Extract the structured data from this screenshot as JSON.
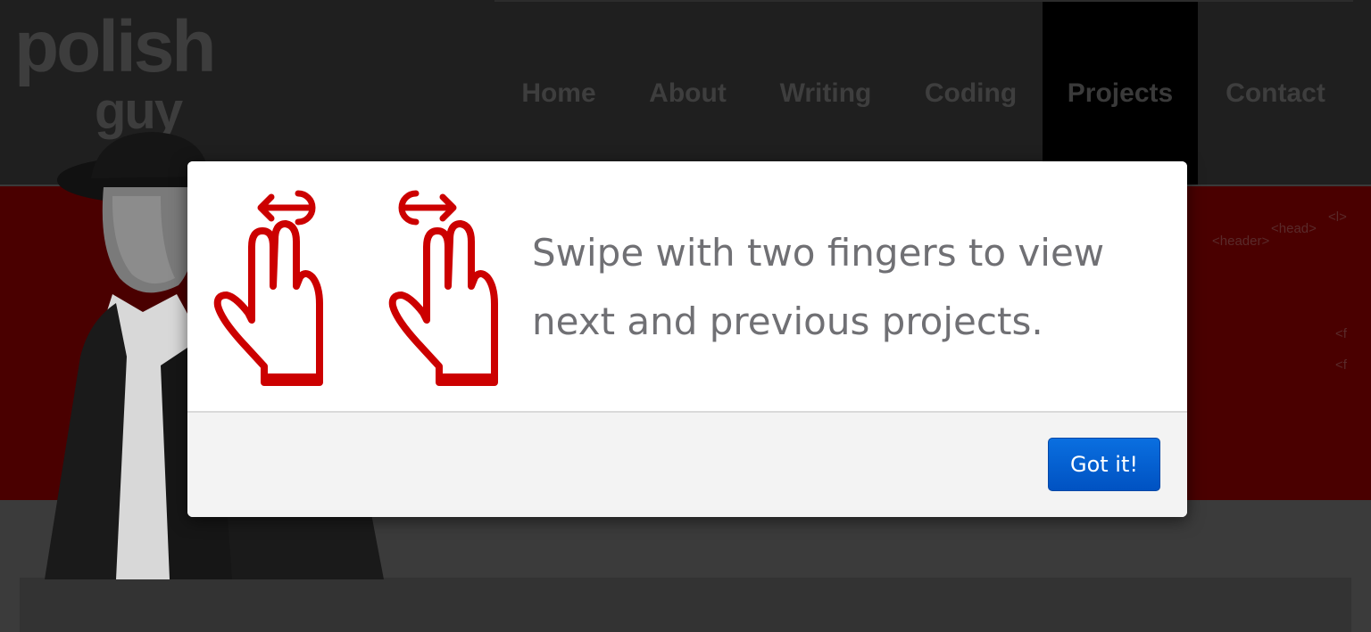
{
  "site": {
    "logo_line1": "polish",
    "logo_line2": "guy"
  },
  "nav": {
    "items": [
      {
        "label": "Home"
      },
      {
        "label": "About"
      },
      {
        "label": "Writing"
      },
      {
        "label": "Coding"
      },
      {
        "label": "Projects",
        "active": true
      },
      {
        "label": "Contact"
      }
    ]
  },
  "hero": {
    "code_snippets": [
      "<header>",
      "<head>",
      "<l>",
      "<f",
      "<f"
    ]
  },
  "modal": {
    "message": "Swipe with two fingers to view next and previous projects.",
    "button_label": "Got it!",
    "icons": [
      "two-finger-swipe-left-icon",
      "two-finger-swipe-right-icon"
    ],
    "icon_color": "#cc0000",
    "button_color": "#0a62d6"
  }
}
